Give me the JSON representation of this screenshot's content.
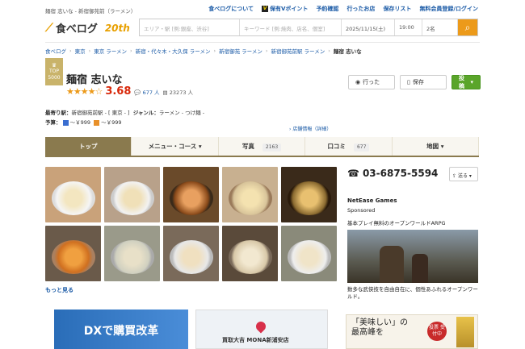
{
  "topbar": {
    "crumb": "麺宿 志いな - 新宿御苑前（ラーメン）",
    "nav": [
      "食べログについて",
      "保有Vポイント",
      "予約確認",
      "行ったお店",
      "保存リスト",
      "無料会員登録/ログイン"
    ]
  },
  "header": {
    "logo_text": "食べログ",
    "anniversary": "20th",
    "search": {
      "area_placeholder": "エリア・駅 [例:銀座、渋谷]",
      "keyword_placeholder": "キーワード [例:焼肉、店名、個室]",
      "date": "2025/11/15(土)",
      "time": "19:00",
      "people": "2名"
    }
  },
  "breadcrumb": [
    "食べログ",
    "東京",
    "東京 ラーメン",
    "新宿・代々木・大久保 ラーメン",
    "新宿御苑 ラーメン",
    "新宿御苑前駅 ラーメン",
    "麺宿 志いな"
  ],
  "restaurant": {
    "award": "TOP 5000",
    "name": "麺宿 志いな",
    "rating": "3.68",
    "reviews": "677 人",
    "saves": "23273 人",
    "station_label": "最寄り駅：",
    "station": "新宿御苑前駅 - [ 東京 - ]",
    "genre_label": "ジャンル：",
    "genre": "ラーメン - つけ麺 -",
    "budget_label": "予算：",
    "budget_dinner": "～￥999",
    "budget_lunch": "～￥999",
    "store_info": "店舗情報（詳細）"
  },
  "actions": {
    "went": "行った",
    "save": "保存",
    "reserve": "投稿"
  },
  "tabs": [
    {
      "label": "トップ"
    },
    {
      "label": "メニュー・コース"
    },
    {
      "label": "写真",
      "count": "2163"
    },
    {
      "label": "口コミ",
      "count": "677"
    },
    {
      "label": "地図"
    }
  ],
  "photos_more": "もっと見る",
  "phone": "03-6875-5594",
  "send": "送る",
  "ad": {
    "advertiser": "NetEase Games",
    "sponsored": "Sponsored",
    "headline": "基本プレイ無料のオープンワールドARPG",
    "desc": "数多な武侠技を自由自在に、個性あふれるオープンワールド。"
  },
  "banners": {
    "b1": "DXで購買改革",
    "b2": "買取大吉 MONA新浦安店",
    "b3_line1": "「美味しい」の",
    "b3_line2": "最高峰を",
    "b3_stamp": "投票 受付中"
  },
  "colors": {
    "accent": "#ec9a1a",
    "tab_active": "#8a7a4e",
    "rating": "#d8280a",
    "link": "#1a5aa6",
    "green": "#5aa52a"
  }
}
